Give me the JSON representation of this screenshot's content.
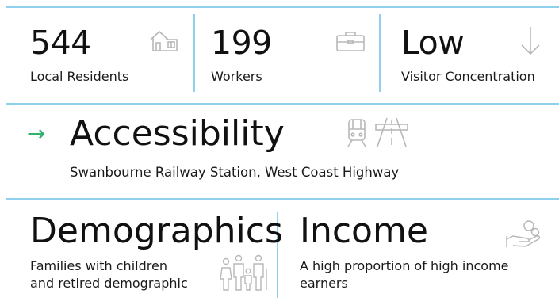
{
  "stats": [
    {
      "value": "544",
      "label": "Local Residents",
      "icon": "house-icon"
    },
    {
      "value": "199",
      "label": "Workers",
      "icon": "briefcase-icon"
    },
    {
      "value": "Low",
      "label": "Visitor Concentration",
      "icon": "arrow-down-icon"
    }
  ],
  "accessibility": {
    "arrow": "→",
    "title": "Accessibility",
    "detail": "Swanbourne Railway Station, West Coast Highway",
    "icons": [
      "train-icon",
      "highway-icon"
    ]
  },
  "demographics": {
    "title": "Demographics",
    "description_line1": "Families with children",
    "description_line2": "and retired demographic",
    "icon": "family-icon"
  },
  "income": {
    "title": "Income",
    "description_line1": "A high proportion of high income",
    "description_line2": "earners",
    "icon": "hand-coins-icon"
  },
  "colors": {
    "divider": "#8fd0ec",
    "accent_arrow": "#2db36d",
    "icon_gray": "#b8b8b8",
    "text": "#111111"
  }
}
